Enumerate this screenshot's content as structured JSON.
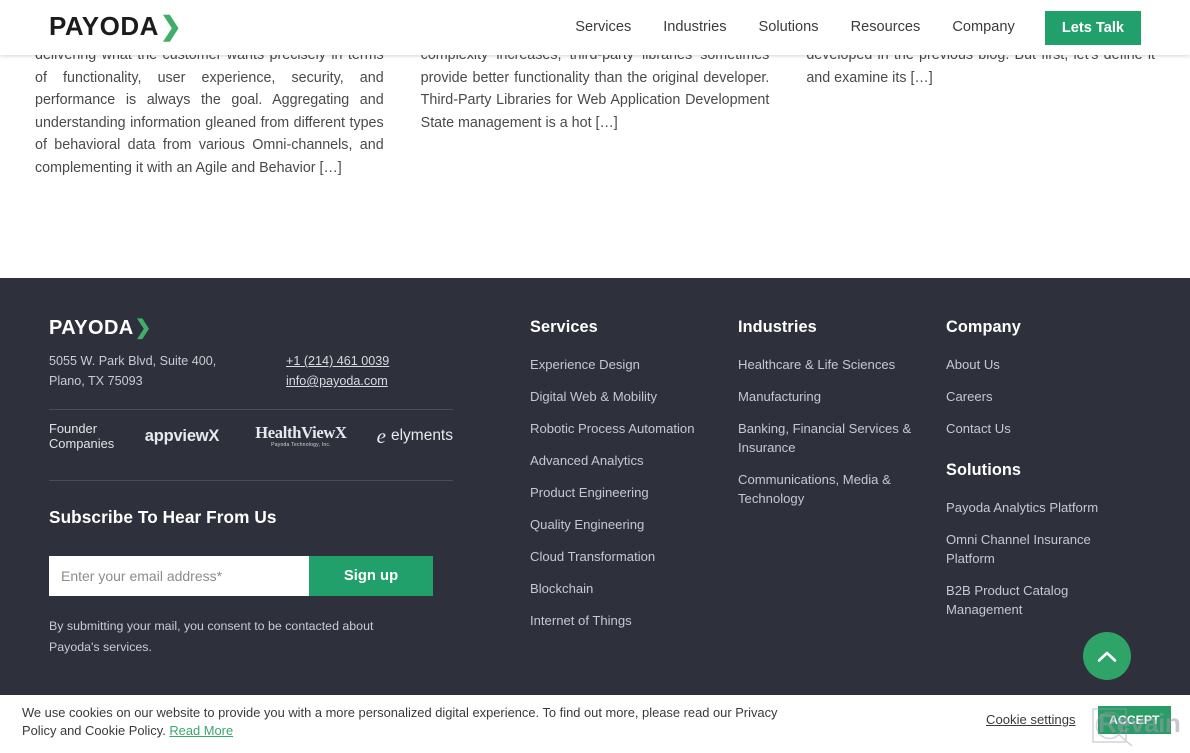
{
  "header": {
    "logo": {
      "word": "PAYODA",
      "chevron": "❯"
    },
    "nav": [
      {
        "label": "Services"
      },
      {
        "label": "Industries"
      },
      {
        "label": "Solutions"
      },
      {
        "label": "Resources"
      },
      {
        "label": "Company"
      }
    ],
    "cta": {
      "label": "Lets Talk",
      "color": "#22a06b"
    }
  },
  "content": {
    "columns": [
      {
        "excerpt": "delivering what the customer wants precisely in terms of functionality, user experience, security, and performance is always the goal. Aggregating and understanding information gleaned from different types of behavioral data from various Omni-channels, and complementing it with an Agile and Behavior […]"
      },
      {
        "excerpt": "complexity increases, third-party libraries sometimes provide better functionality than the original developer. Third-Party Libraries for Web Application Development State management is a hot […]"
      },
      {
        "excerpt": "developed in the previous blog. But first, let's define it and examine its […]"
      }
    ]
  },
  "footer": {
    "background": "#2e313b",
    "logo": {
      "word": "PAYODA",
      "chevron": "❯"
    },
    "address": {
      "line1": "5055 W. Park Blvd, Suite 400,",
      "line2": "Plano, TX 75093"
    },
    "contact": {
      "phone": "+1 (214) 461 0039",
      "email": "info@payoda.com"
    },
    "founders": {
      "label": "Founder Companies",
      "brands": [
        {
          "name": "appviewX"
        },
        {
          "name": "HealthViewX",
          "sub": "Payoda Technology, Inc."
        },
        {
          "name": "elyments",
          "mark": "e"
        }
      ]
    },
    "subscribe": {
      "title": "Subscribe To Hear From Us",
      "input_value": "",
      "placeholder": "Enter your email address*",
      "button": "Sign up",
      "consent": "By submitting your mail, you consent to be contacted about Payoda's services."
    },
    "services": {
      "heading": "Services",
      "links": [
        "Experience Design",
        "Digital Web & Mobility",
        "Robotic Process Automation",
        "Advanced Analytics",
        "Product Engineering",
        "Quality Engineering",
        "Cloud Transformation",
        "Blockchain",
        "Internet of Things"
      ]
    },
    "industries": {
      "heading": "Industries",
      "links": [
        "Healthcare & Life Sciences",
        "Manufacturing",
        "Banking, Financial Services & Insurance",
        "Communications, Media & Technology"
      ]
    },
    "company": {
      "heading": "Company",
      "links": [
        "About Us",
        "Careers",
        "Contact Us"
      ]
    },
    "solutions": {
      "heading": "Solutions",
      "links": [
        "Payoda Analytics Platform",
        "Omni Channel Insurance Platform",
        "B2B Product Catalog Management"
      ]
    }
  },
  "scroll_top": {
    "icon": "chevron-up-icon",
    "color": "#2fa468"
  },
  "cookie_banner": {
    "text": "We use cookies on our website to provide you with a more personalized digital experience. To find out more, please read our Privacy Policy and Cookie Policy.",
    "read_more": "Read More",
    "settings_label": "Cookie settings",
    "accept_label": "ACCEPT",
    "accept_color": "#2a9d66",
    "link_color": "#3aa76d"
  },
  "watermark": {
    "text": "Revain"
  }
}
